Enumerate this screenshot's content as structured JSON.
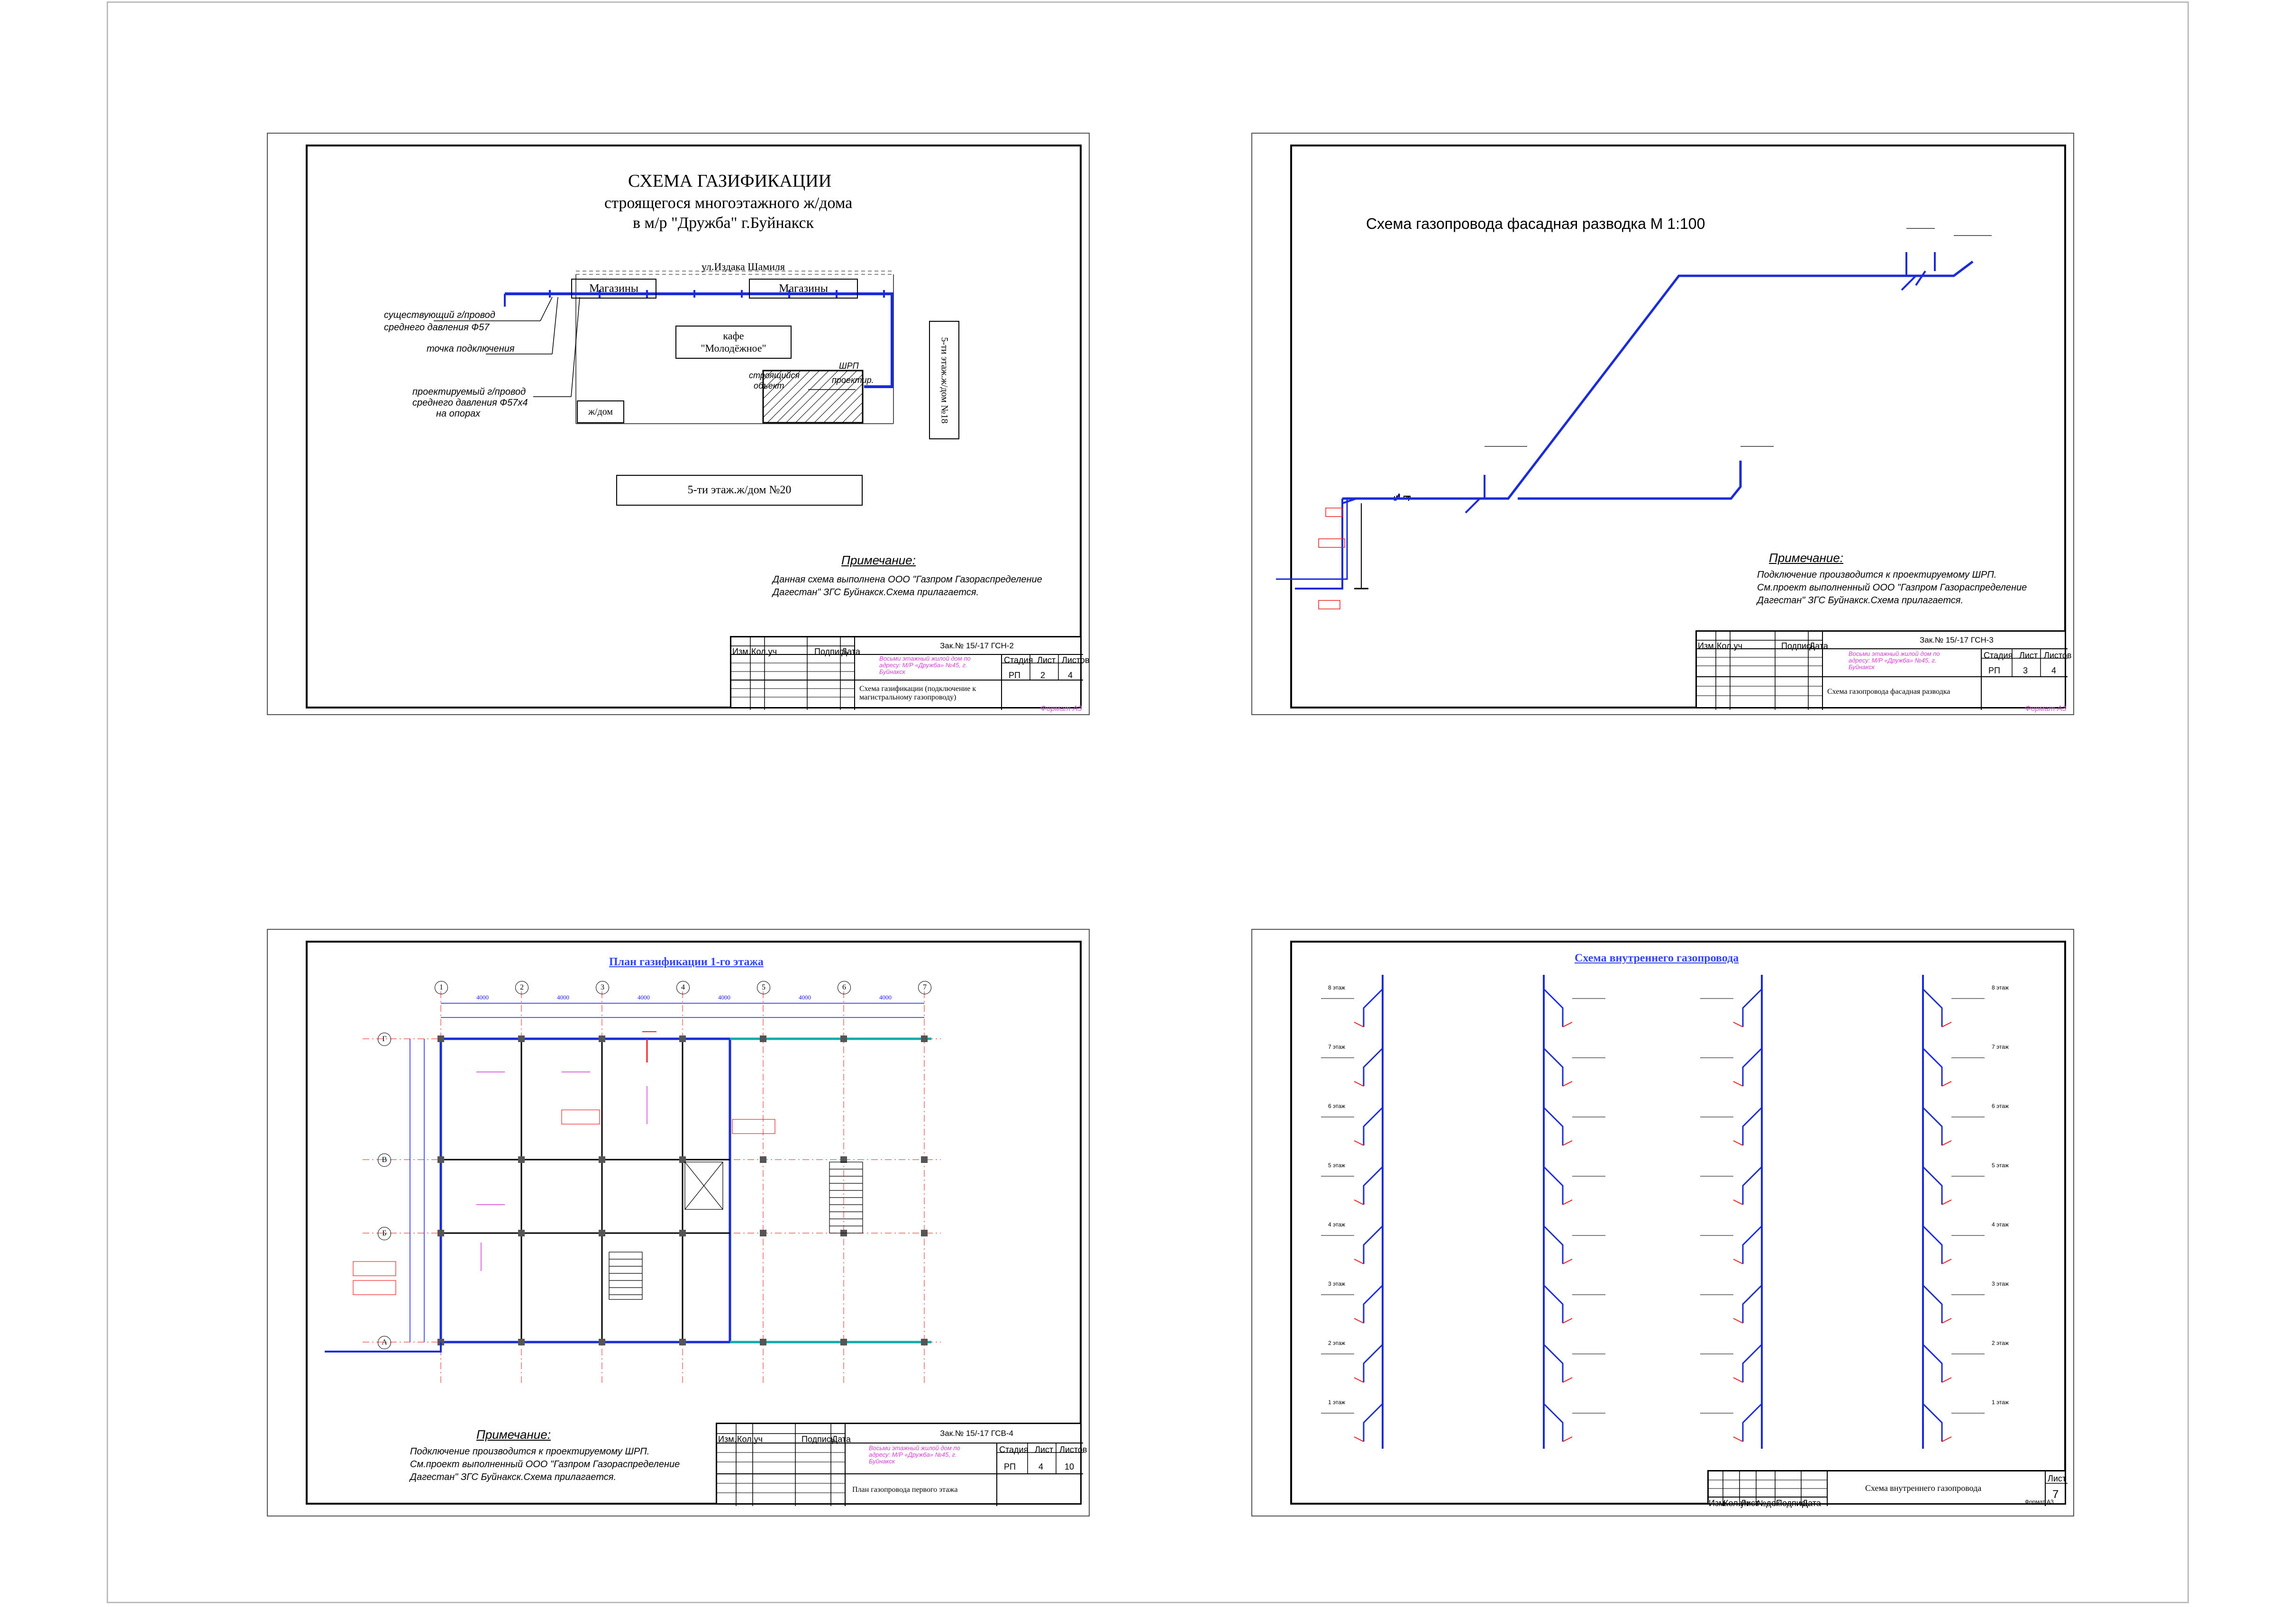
{
  "sheet1": {
    "title": "СХЕМА ГАЗИФИКАЦИИ",
    "subtitle1": "строящегося многоэтажного ж/дома",
    "subtitle2": "в м/р \"Дружба\" г.Буйнакск",
    "street": "ул.Издака Шамиля",
    "shop1": "Магазины",
    "shop2": "Магазины",
    "cafe_line1": "кафе",
    "cafe_line2": "\"Молодёжное\"",
    "house_small": "ж/дом",
    "house20": "5-ти этаж.ж/дом №20",
    "house18": "5-ти этаж.ж/дом №18",
    "object_line1": "строящийся",
    "object_line2": "объект",
    "shrp_line1": "ШРП",
    "shrp_line2": "проектир.",
    "leader1_line1": "существующий г/провод",
    "leader1_line2": "среднего давления Ф57",
    "leader2": "точка подключения",
    "leader3_line1": "проектируемый г/провод",
    "leader3_line2": "среднего давления Ф57х4",
    "leader3_line3": "на опорах",
    "note_title": "Примечание:",
    "note_line1": "Данная схема выполнена ООО \"Газпром Газораспределение",
    "note_line2": "Дагестан\" ЗГС Буйнакск.Схема прилагается.",
    "stamp_code": "Зак.№ 15/-17   ГСН-2",
    "stamp_desc": "Схема газификации (подключение к магистральному газопроводу)",
    "stamp_stage": "РП",
    "stamp_sheet": "2",
    "stamp_sheets": "4",
    "format": "Формат А3"
  },
  "sheet2": {
    "title": "Схема газопровода фасадная разводка М 1:100",
    "note_title": "Примечание:",
    "note_line1": "Подключение производится к проектируемому ШРП.",
    "note_line2": "См.проект выполненный ООО \"Газпром Газораспределение",
    "note_line3": "Дагестан\" ЗГС Буйнакск.Схема прилагается.",
    "stamp_code": "Зак.№ 15/-17   ГСН-3",
    "stamp_desc": "Схема газопровода фасадная разводка",
    "stamp_stage": "РП",
    "stamp_sheet": "3",
    "stamp_sheets": "4",
    "format": "Формат А3"
  },
  "sheet3": {
    "title": "План газификации 1-го этажа",
    "note_title": "Примечание:",
    "note_line1": "Подключение производится к проектируемому ШРП.",
    "note_line2": "См.проект выполненный ООО \"Газпром Газораспределение",
    "note_line3": "Дагестан\" ЗГС Буйнакск.Схема прилагается.",
    "stamp_code": "Зак.№ 15/-17   ГСВ-4",
    "stamp_desc": "План газопровода первого этажа",
    "stamp_stage": "РП",
    "stamp_sheet": "4",
    "stamp_sheets": "10",
    "axes_top": [
      "1",
      "2",
      "3",
      "4",
      "5",
      "6",
      "7"
    ],
    "axes_left": [
      "Г",
      "В",
      "Б",
      "А"
    ],
    "dim": "4000"
  },
  "sheet4": {
    "title": "Схема внутреннего газопровода",
    "stamp_desc": "Схема внутреннего газопровода",
    "stamp_sheet_label": "Лист",
    "stamp_sheet": "7",
    "stamp_cols": [
      "Изм.",
      "Кол.уч",
      "Лист",
      "№док",
      "Подпись",
      "Дата"
    ],
    "floors": [
      "8 этаж",
      "7 этаж",
      "6 этаж",
      "5 этаж",
      "4 этаж",
      "3 этаж",
      "2 этаж",
      "1 этаж"
    ],
    "format": "Формат А3"
  },
  "stamp_headers": [
    "Изм.",
    "Кол.уч",
    "Лист",
    "№док",
    "Подпись",
    "Дата"
  ],
  "stamp_small_headers": [
    "Стадия",
    "Лист",
    "Листов"
  ],
  "stamp_pink_text": "Восьми этажный жилой дом по адресу: М/Р «Дружба» №45, г. Буйнакск"
}
